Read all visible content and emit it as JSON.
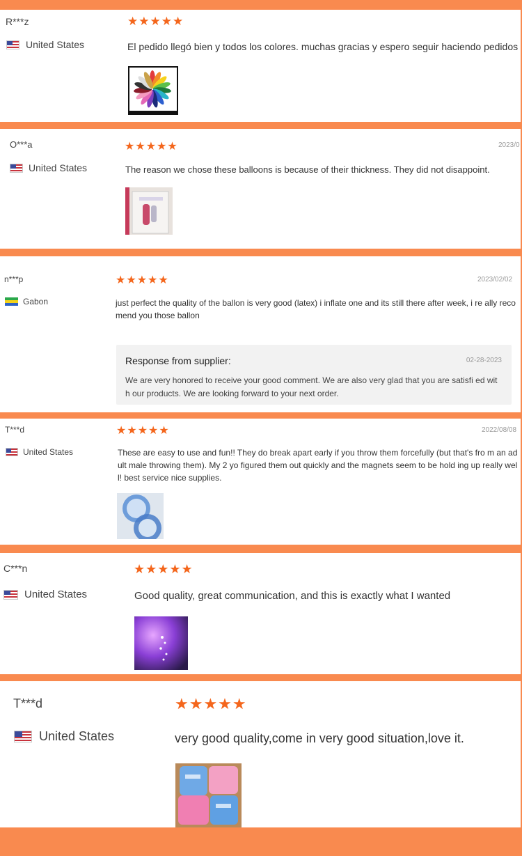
{
  "reviews": [
    {
      "name": "R***z",
      "country": "United States",
      "flag": "us-flag-icon",
      "rating": "★★★★★",
      "date": "",
      "text": "El pedido llegó bien y todos los colores. muchas gracias y espero seguir haciendo pedidos",
      "photo": "balloon-color-chart-photo"
    },
    {
      "name": "O***a",
      "country": "United States",
      "flag": "us-flag-icon",
      "rating": "★★★★★",
      "date": "2023/0",
      "text": "The reason we chose these balloons is because of their thickness. They did not disappoint.",
      "photo": "foil-balloon-package-photo"
    },
    {
      "name": "n***p",
      "country": "Gabon",
      "flag": "gabon-flag-icon",
      "rating": "★★★★★",
      "date": "2023/02/02",
      "text": "just perfect the quality of the ballon is very good (latex) i inflate one and its still there after week, i re ally recomend you those ballon",
      "reply": {
        "title": "Response from supplier:",
        "date": "02-28-2023",
        "text": "We are very honored to receive your good comment. We are also very glad that you are satisfi ed with our products. We are looking forward to your next order."
      }
    },
    {
      "name": "T***d",
      "country": "United States",
      "flag": "us-flag-icon",
      "rating": "★★★★★",
      "date": "2022/08/08",
      "text": "These are easy to use and fun!! They do break apart early if you throw them forcefully (but that's fro m an adult male throwing them). My 2 yo figured them out quickly and the magnets seem to be hold ing up really well! best service nice supplies.",
      "photo": "blue-balloons-photo"
    },
    {
      "name": "C***n",
      "country": "United States",
      "flag": "us-flag-icon",
      "rating": "★★★★★",
      "date": "",
      "text": "Good quality, great communication, and this is exactly what I wanted",
      "photo": "purple-lights-photo"
    },
    {
      "name": "T***d",
      "country": "United States",
      "flag": "us-flag-icon",
      "rating": "★★★★★",
      "date": "",
      "text": "very good quality,come in very good situation,love it.",
      "photo": "pink-blue-balloons-box-photo"
    }
  ],
  "colors": {
    "background": "#f98a4f",
    "star": "#f4661c",
    "card": "#ffffff",
    "reply_bg": "#f2f2f2"
  }
}
